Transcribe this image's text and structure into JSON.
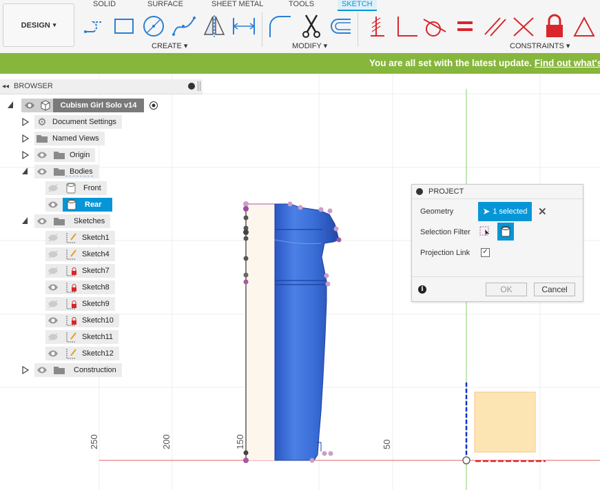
{
  "workspace": {
    "label": "DESIGN",
    "chevron": "▾"
  },
  "tabs": [
    "SOLID",
    "SURFACE",
    "SHEET METAL",
    "TOOLS",
    "SKETCH"
  ],
  "active_tab": "SKETCH",
  "groups": {
    "create": "CREATE ▾",
    "modify": "MODIFY ▾",
    "constraints": "CONSTRAINTS ▾"
  },
  "banner": {
    "text": "You are all set with the latest update.",
    "link": "Find out what's"
  },
  "browser": {
    "title": "BROWSER",
    "document": "Cubism Girl Solo v14",
    "items": {
      "document_settings": "Document Settings",
      "named_views": "Named Views",
      "origin": "Origin",
      "bodies": "Bodies",
      "front": "Front",
      "rear": "Rear",
      "sketches": "Sketches",
      "construction": "Construction"
    },
    "sketches": [
      "Sketch1",
      "Sketch4",
      "Sketch7",
      "Sketch8",
      "Sketch9",
      "Sketch10",
      "Sketch11",
      "Sketch12"
    ]
  },
  "dialog": {
    "title": "PROJECT",
    "geometry_label": "Geometry",
    "geometry_value": "1 selected",
    "selection_filter_label": "Selection Filter",
    "projection_link_label": "Projection Link",
    "projection_link_checked": true,
    "ok": "OK",
    "cancel": "Cancel"
  },
  "axis_labels": [
    "250",
    "200",
    "150",
    "50"
  ],
  "colors": {
    "accent": "#0696d7",
    "banner": "#87b63d",
    "body_blue": "#3a6fd8",
    "constraint_red": "#d9252b",
    "sketch_point": "#a35aa5"
  }
}
